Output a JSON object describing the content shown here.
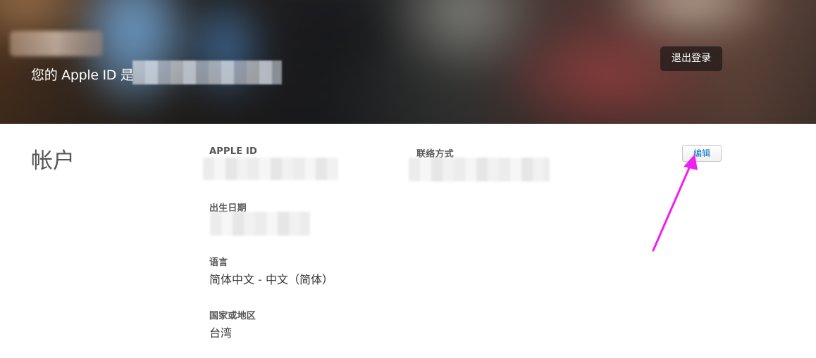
{
  "hero": {
    "title_prefix": "您的 Apple ID 是",
    "signout_label": "退出登录"
  },
  "account": {
    "section_title": "帐户",
    "edit_label": "编辑",
    "fields": {
      "apple_id": {
        "label": "APPLE ID"
      },
      "contact": {
        "label": "联络方式"
      },
      "birthday": {
        "label": "出生日期"
      },
      "language": {
        "label": "语言",
        "value": "简体中文 - 中文（简体）"
      },
      "region": {
        "label": "国家或地区",
        "value": "台湾"
      }
    }
  },
  "colors": {
    "accent_link": "#0070c9",
    "annotation_arrow": "#f020f0"
  },
  "icons": {
    "annotation": "arrow-pointer-icon"
  }
}
